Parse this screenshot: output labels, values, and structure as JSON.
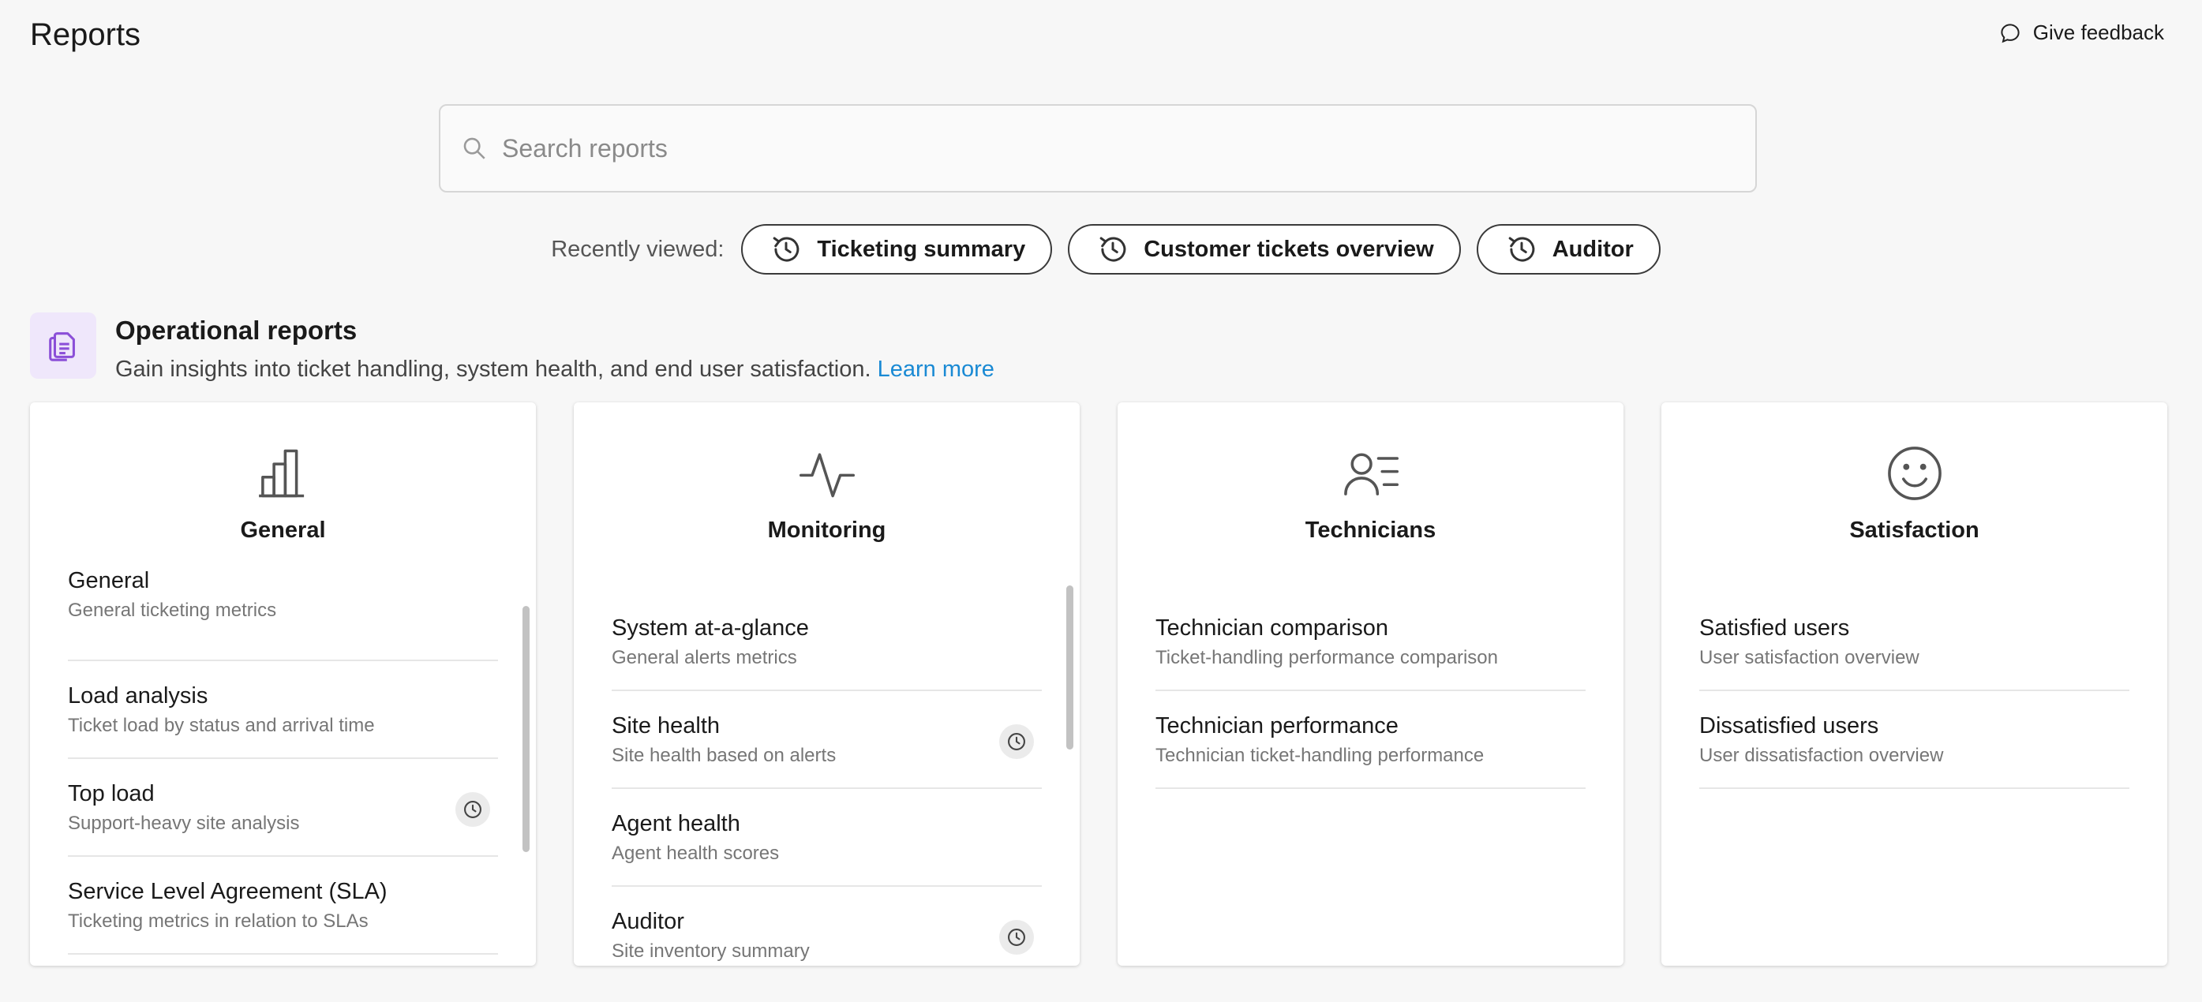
{
  "page": {
    "title": "Reports"
  },
  "feedback": {
    "label": "Give feedback"
  },
  "search": {
    "placeholder": "Search reports"
  },
  "recent": {
    "label": "Recently viewed:",
    "items": [
      "Ticketing summary",
      "Customer tickets overview",
      "Auditor"
    ]
  },
  "section": {
    "title": "Operational reports",
    "description": "Gain insights into ticket handling, system health, and end user satisfaction.",
    "link": "Learn more"
  },
  "colors": {
    "accent": "#1a8ad4",
    "section_icon_bg": "#efe7fb",
    "section_icon": "#8b4fd8"
  },
  "cards": [
    {
      "title": "General",
      "icon": "bar-chart-icon",
      "items": [
        {
          "title": "General",
          "sub": "General ticketing metrics",
          "recent": false
        },
        {
          "title": "Load analysis",
          "sub": "Ticket load by status and arrival time",
          "recent": false
        },
        {
          "title": "Top load",
          "sub": "Support-heavy site analysis",
          "recent": true
        },
        {
          "title": "Service Level Agreement (SLA)",
          "sub": "Ticketing metrics in relation to SLAs",
          "recent": false
        }
      ]
    },
    {
      "title": "Monitoring",
      "icon": "pulse-icon",
      "items": [
        {
          "title": "System at-a-glance",
          "sub": "General alerts metrics",
          "recent": false
        },
        {
          "title": "Site health",
          "sub": "Site health based on alerts",
          "recent": true
        },
        {
          "title": "Agent health",
          "sub": "Agent health scores",
          "recent": false
        },
        {
          "title": "Auditor",
          "sub": "Site inventory summary",
          "recent": true
        }
      ]
    },
    {
      "title": "Technicians",
      "icon": "user-list-icon",
      "items": [
        {
          "title": "Technician comparison",
          "sub": "Ticket-handling performance comparison",
          "recent": false
        },
        {
          "title": "Technician performance",
          "sub": "Technician ticket-handling performance",
          "recent": false
        }
      ]
    },
    {
      "title": "Satisfaction",
      "icon": "smiley-icon",
      "items": [
        {
          "title": "Satisfied users",
          "sub": "User satisfaction overview",
          "recent": false
        },
        {
          "title": "Dissatisfied users",
          "sub": "User dissatisfaction overview",
          "recent": false
        }
      ]
    }
  ]
}
